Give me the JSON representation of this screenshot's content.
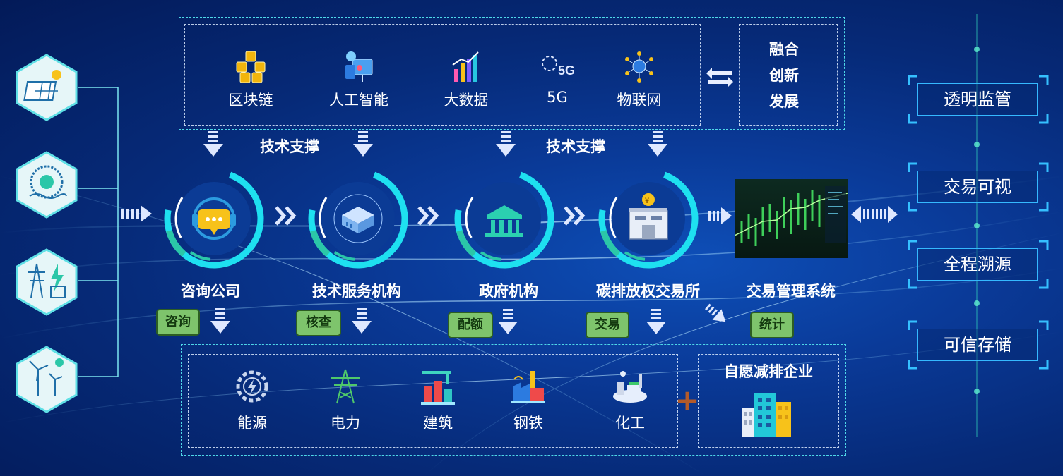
{
  "tech_support": {
    "items": [
      {
        "label": "区块链",
        "icon": "blockchain-icon"
      },
      {
        "label": "人工智能",
        "icon": "ai-icon"
      },
      {
        "label": "大数据",
        "icon": "big-data-icon"
      },
      {
        "label": "5G",
        "icon": "5g-icon"
      },
      {
        "label": "物联网",
        "icon": "iot-icon"
      }
    ],
    "fusion": [
      "融合",
      "创新",
      "发展"
    ],
    "support_labels": [
      "技术支撑",
      "技术支撑"
    ]
  },
  "sources": [
    "solar-panel-icon",
    "hydro-icon",
    "power-tower-icon",
    "wind-turbine-icon"
  ],
  "flow": {
    "nodes": [
      {
        "label": "咨询公司",
        "tag": "咨询",
        "icon": "headset-chat-icon"
      },
      {
        "label": "技术服务机构",
        "tag": "核查",
        "icon": "server-icon"
      },
      {
        "label": "政府机构",
        "tag": "配额",
        "icon": "government-building-icon"
      },
      {
        "label": "碳排放权交易所",
        "tag": "交易",
        "icon": "exchange-building-icon"
      },
      {
        "label": "交易管理系统",
        "tag": "统计",
        "icon": "stock-chart-image"
      }
    ]
  },
  "industries": {
    "items": [
      {
        "label": "能源",
        "icon": "energy-gear-icon"
      },
      {
        "label": "电力",
        "icon": "power-pylon-icon"
      },
      {
        "label": "建筑",
        "icon": "construction-icon"
      },
      {
        "label": "钢铁",
        "icon": "steel-factory-icon"
      },
      {
        "label": "化工",
        "icon": "chemical-plant-icon"
      }
    ],
    "plus": "+",
    "voluntary": "自愿减排企业"
  },
  "features": [
    "透明监管",
    "交易可视",
    "全程溯源",
    "可信存储"
  ],
  "colors": {
    "cyan": "#1ee0f0",
    "tag_green": "#7ec46c",
    "bg": "#062a78",
    "ring_teal": "#2bc7a8"
  }
}
